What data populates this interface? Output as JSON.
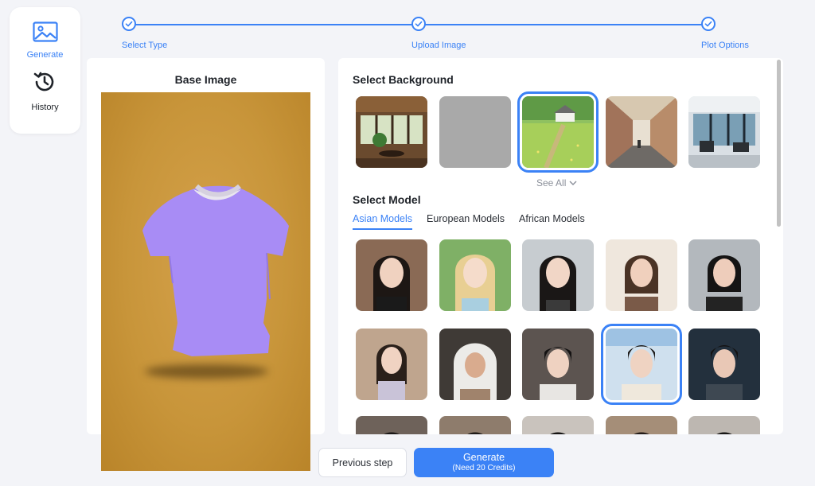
{
  "nav": {
    "generate_label": "Generate",
    "history_label": "History"
  },
  "steps": [
    {
      "label": "Select Type"
    },
    {
      "label": "Upload Image"
    },
    {
      "label": "Plot Options"
    }
  ],
  "base": {
    "title": "Base Image"
  },
  "options": {
    "background_title": "Select Background",
    "see_all_label": "See All",
    "model_title": "Select Model",
    "tabs": [
      {
        "label": "Asian Models",
        "active": true
      },
      {
        "label": "European Models",
        "active": false
      },
      {
        "label": "African Models",
        "active": false
      }
    ],
    "selected_background": 3,
    "selected_model": 9
  },
  "buttons": {
    "previous_label": "Previous step",
    "generate_label": "Generate",
    "generate_sub": "(Need 20 Credits)"
  },
  "colors": {
    "accent": "#3b82f6",
    "base_bg": "#c8953a",
    "shirt": "#a88cf5"
  }
}
